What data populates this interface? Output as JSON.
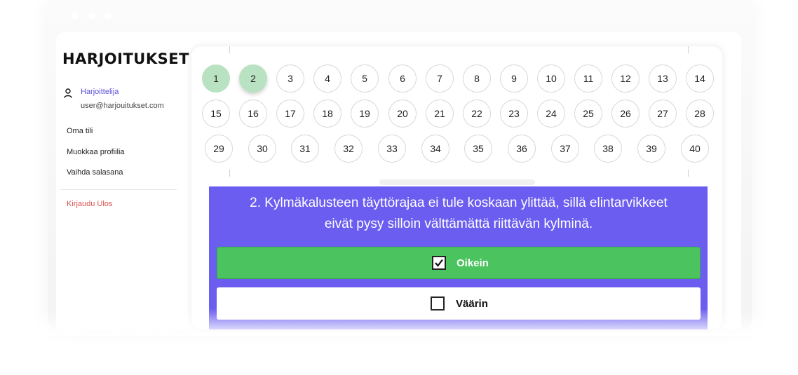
{
  "brand": {
    "logo_text": "HARJOITUKSET"
  },
  "user": {
    "name": "Harjoittelija",
    "email": "user@harjouitukset.com"
  },
  "menu": {
    "items": [
      {
        "label": "Oma tili"
      },
      {
        "label": "Muokkaa profiilia"
      },
      {
        "label": "Vaihda salasana"
      }
    ],
    "logout_label": "Kirjaudu Ulos"
  },
  "questions": {
    "numbers": [
      "1",
      "2",
      "3",
      "4",
      "5",
      "6",
      "7",
      "8",
      "9",
      "10",
      "11",
      "12",
      "13",
      "14",
      "15",
      "16",
      "17",
      "18",
      "19",
      "20",
      "21",
      "22",
      "23",
      "24",
      "25",
      "26",
      "27",
      "28",
      "29",
      "30",
      "31",
      "32",
      "33",
      "34",
      "35",
      "36",
      "37",
      "38",
      "39",
      "40"
    ],
    "answered": [
      1
    ],
    "current": 2
  },
  "question": {
    "line1": "2. Kylmäkalusteen täyttörajaa ei tule koskaan ylittää, sillä elintarvikkeet",
    "line2": "eivät pysy silloin välttämättä riittävän kylminä."
  },
  "answers": {
    "correct_label": "Oikein",
    "wrong_label": "Väärin",
    "selected": "correct"
  },
  "colors": {
    "accent": "#6a5df0",
    "correct": "#4bc35f",
    "answered": "#b8e2c2",
    "logout": "#d9534f",
    "user_name": "#5b4fd9"
  }
}
